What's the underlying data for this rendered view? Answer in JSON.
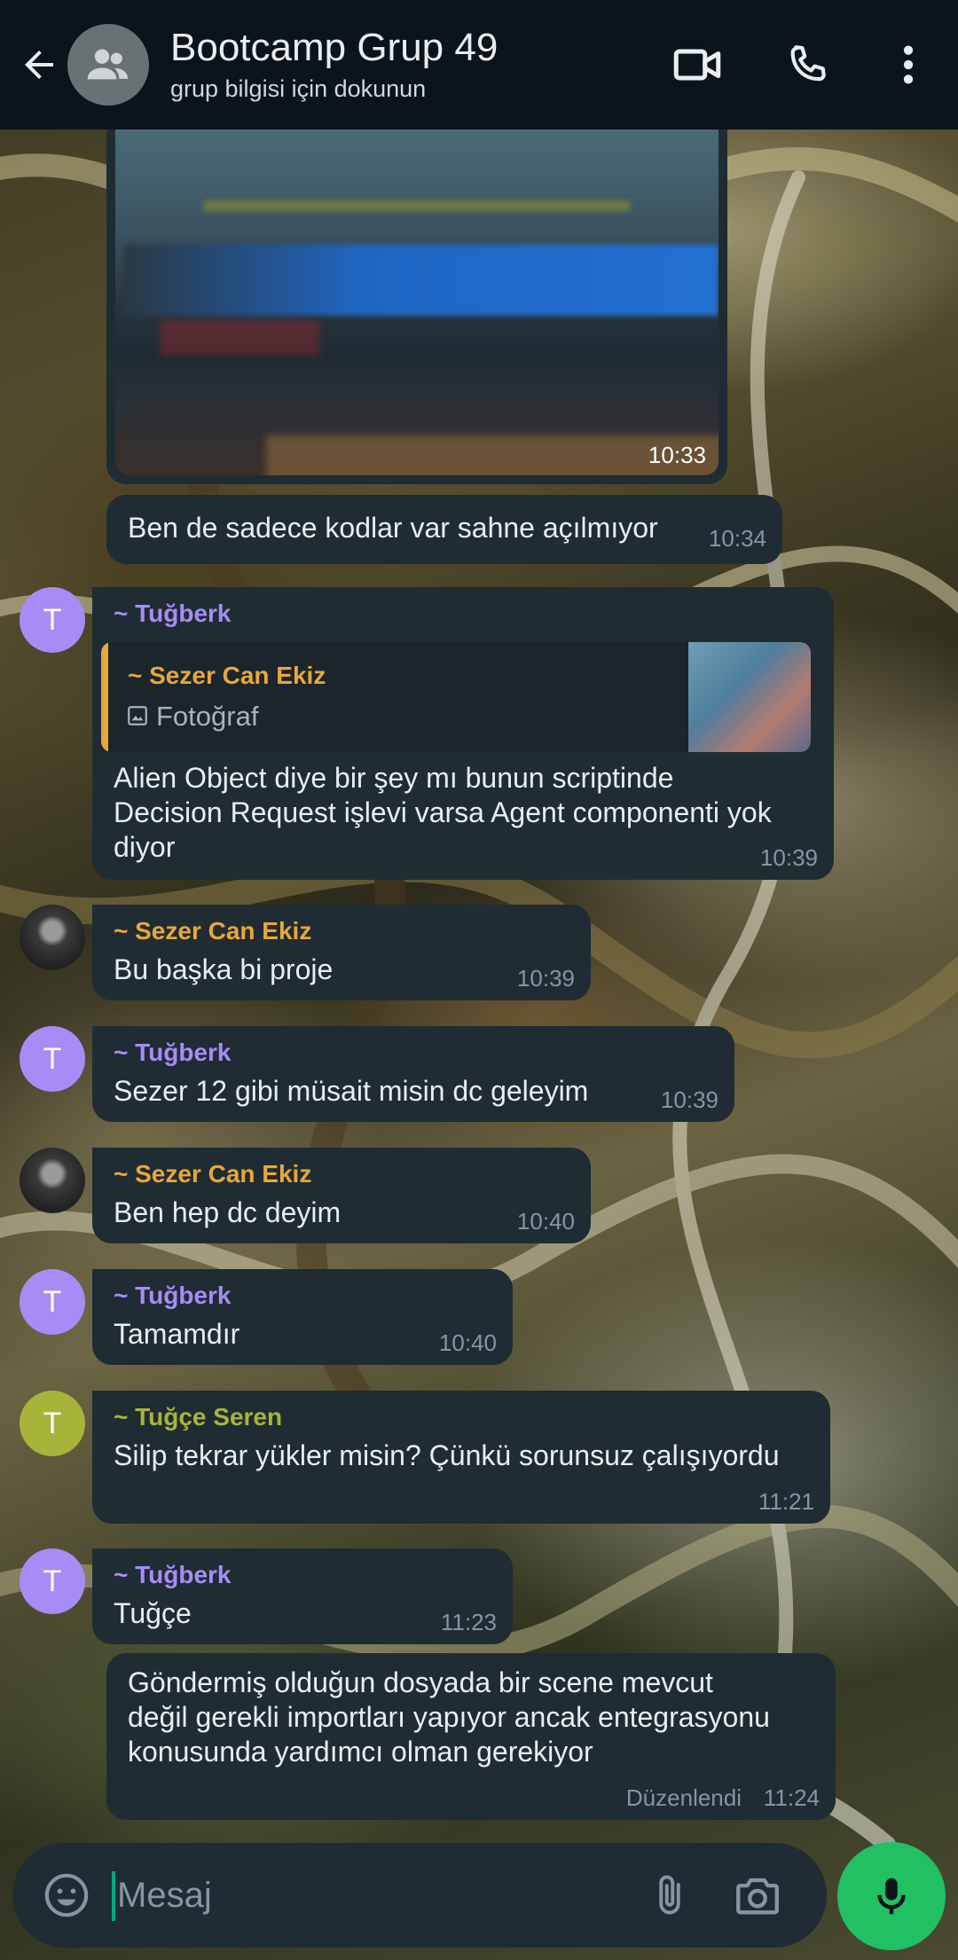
{
  "header": {
    "title": "Bootcamp Grup 49",
    "subtitle": "grup bilgisi için dokunun",
    "icons": [
      "back-arrow-icon",
      "group-icon",
      "video-call-icon",
      "phone-icon",
      "more-vert-icon"
    ]
  },
  "messages": [
    {
      "type": "image",
      "time": "10:33"
    },
    {
      "text": "Ben de sadece kodlar var sahne açılmıyor",
      "time": "10:34"
    },
    {
      "sender": "~ Tuğberk",
      "avatar_letter": "T",
      "quote": {
        "name": "~ Sezer Can Ekiz",
        "type": "Fotoğraf"
      },
      "lines": [
        "Alien Object diye bir şey mı bunun scriptinde",
        "Decision Request işlevi varsa Agent componenti yok",
        "diyor"
      ],
      "time": "10:39"
    },
    {
      "sender": "~ Sezer Can Ekiz",
      "text": "Bu başka bi proje",
      "time": "10:39"
    },
    {
      "sender": "~ Tuğberk",
      "avatar_letter": "T",
      "text": "Sezer 12 gibi müsait misin dc geleyim",
      "time": "10:39"
    },
    {
      "sender": "~ Sezer Can Ekiz",
      "text": "Ben hep dc deyim",
      "time": "10:40"
    },
    {
      "sender": "~ Tuğberk",
      "avatar_letter": "T",
      "text": "Tamamdır",
      "time": "10:40"
    },
    {
      "sender": "~ Tuğçe Seren",
      "avatar_letter": "T",
      "text": "Silip tekrar yükler misin? Çünkü sorunsuz çalışıyordu",
      "time": "11:21"
    },
    {
      "sender": "~ Tuğberk",
      "avatar_letter": "T",
      "text": "Tuğçe",
      "time": "11:23"
    },
    {
      "lines": [
        "Göndermiş olduğun dosyada bir scene mevcut",
        "değil gerekli importları yapıyor ancak entegrasyonu",
        "konusunda yardımcı olman gerekiyor"
      ],
      "edited": "Düzenlendi",
      "time": "11:24"
    }
  ],
  "input": {
    "placeholder": "Mesaj"
  },
  "colors": {
    "header_bg": "#0b141a",
    "bubble_bg": "#202c33",
    "tugberk": "#a88cf5",
    "sezer": "#e8a73b",
    "tugce": "#a7b43a",
    "accent_green": "#21c063",
    "time_gray": "#8696a0"
  }
}
